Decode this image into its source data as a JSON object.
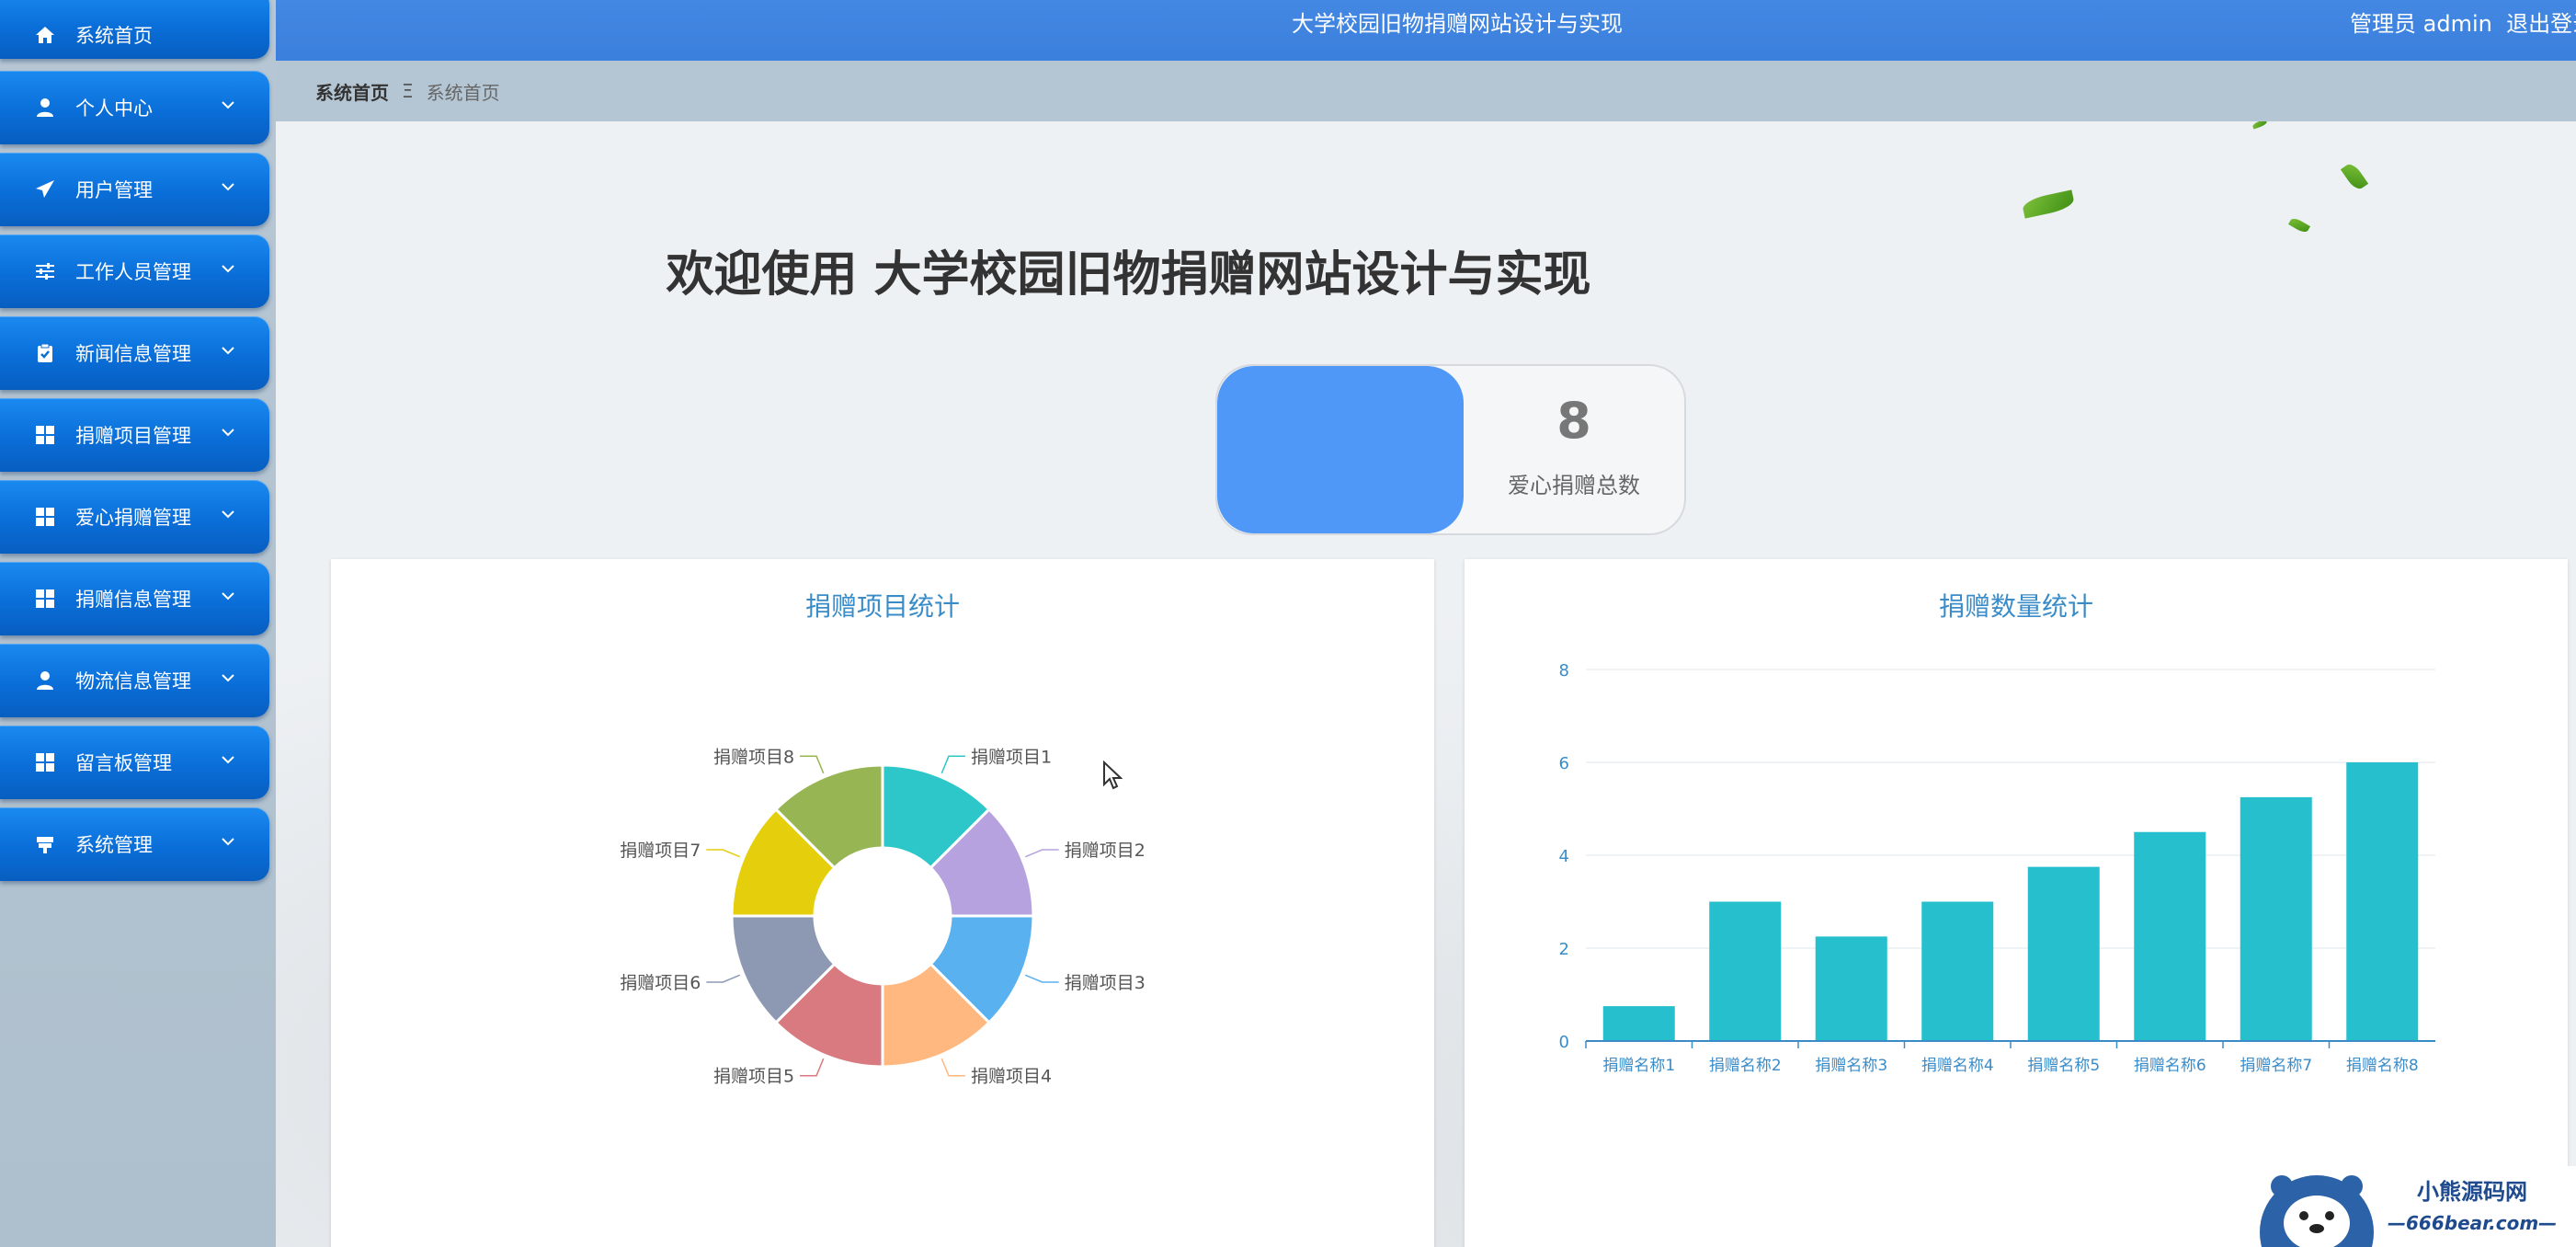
{
  "app": {
    "title": "大学校园旧物捐赠网站设计与实现",
    "user_text": "管理员 admin",
    "logout": "退出登录"
  },
  "sidebar": {
    "items": [
      {
        "label": "系统首页",
        "icon": "home-icon"
      },
      {
        "label": "个人中心",
        "icon": "user-icon"
      },
      {
        "label": "用户管理",
        "icon": "send-icon"
      },
      {
        "label": "工作人员管理",
        "icon": "sliders-icon"
      },
      {
        "label": "新闻信息管理",
        "icon": "clipboard-check-icon"
      },
      {
        "label": "捐赠项目管理",
        "icon": "grid-icon"
      },
      {
        "label": "爱心捐赠管理",
        "icon": "grid-icon"
      },
      {
        "label": "捐赠信息管理",
        "icon": "grid-icon"
      },
      {
        "label": "物流信息管理",
        "icon": "user-icon"
      },
      {
        "label": "留言板管理",
        "icon": "grid-icon"
      },
      {
        "label": "系统管理",
        "icon": "signpost-icon"
      }
    ]
  },
  "breadcrumb": {
    "home": "系统首页",
    "separator": "Ξ",
    "current": "系统首页"
  },
  "main": {
    "welcome": "欢迎使用 大学校园旧物捐赠网站设计与实现",
    "stat": {
      "value": "8",
      "label": "爱心捐赠总数"
    }
  },
  "watermark": {
    "name": "小熊源码网",
    "url": "—666bear.com—"
  },
  "chart_data": [
    {
      "type": "pie",
      "title": "捐赠项目统计",
      "categories": [
        "捐赠项目1",
        "捐赠项目2",
        "捐赠项目3",
        "捐赠项目4",
        "捐赠项目5",
        "捐赠项目6",
        "捐赠项目7",
        "捐赠项目8"
      ],
      "values": [
        1,
        1,
        1,
        1,
        1,
        1,
        1,
        1
      ],
      "colors": [
        "#2ec7c9",
        "#b6a2de",
        "#5ab1ef",
        "#ffb980",
        "#d87a80",
        "#8d98b3",
        "#e5cf0d",
        "#97b552"
      ],
      "donut": true
    },
    {
      "type": "bar",
      "title": "捐赠数量统计",
      "categories": [
        "捐赠名称1",
        "捐赠名称2",
        "捐赠名称3",
        "捐赠名称4",
        "捐赠名称5",
        "捐赠名称6",
        "捐赠名称7",
        "捐赠名称8"
      ],
      "values": [
        0.75,
        3,
        2.25,
        3,
        3.75,
        4.5,
        5.25,
        6
      ],
      "ylim": [
        0,
        8
      ],
      "yticks": [
        0,
        2,
        4,
        6,
        8
      ],
      "color": "#26bfcd",
      "grid": true
    }
  ]
}
